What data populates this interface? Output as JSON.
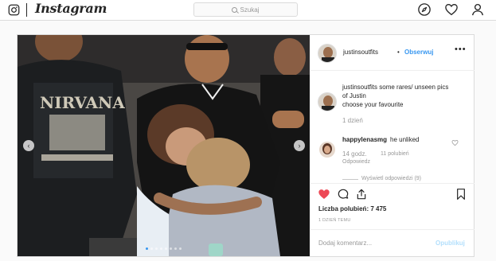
{
  "nav": {
    "wordmark": "Instagram",
    "search_placeholder": "Szukaj",
    "icons": [
      "instagram-glyph-icon",
      "compass-icon",
      "heart-icon",
      "profile-icon"
    ]
  },
  "post": {
    "username": "justinsoutfits",
    "separator": "•",
    "follow_label": "Obserwuj",
    "more_label": "•••",
    "caption": {
      "username": "justinsoutfits",
      "text_line1": " some rares/ unseen pics",
      "text_line2": "of Justin",
      "text_line3": "choose your favourite"
    },
    "caption_time": "1 dzień",
    "comment": {
      "username": "happylenasmg",
      "text": "he unliked",
      "time": "14 godz.",
      "likes": "11 polubień",
      "reply_label": "Odpowiedz",
      "view_replies": "Wyświetl odpowiedzi (9)"
    },
    "likes_text": "Liczba polubień: 7 475",
    "posted_time": "1 DZIEŃ TEMU",
    "add_comment_placeholder": "Dodaj komentarz...",
    "publish_label": "Opublikuj",
    "carousel": {
      "prev": "‹",
      "next": "›",
      "slide_count": 8,
      "active_slide": 1
    },
    "colors": {
      "accent": "#3897f0",
      "liked_heart": "#ed4956"
    }
  }
}
